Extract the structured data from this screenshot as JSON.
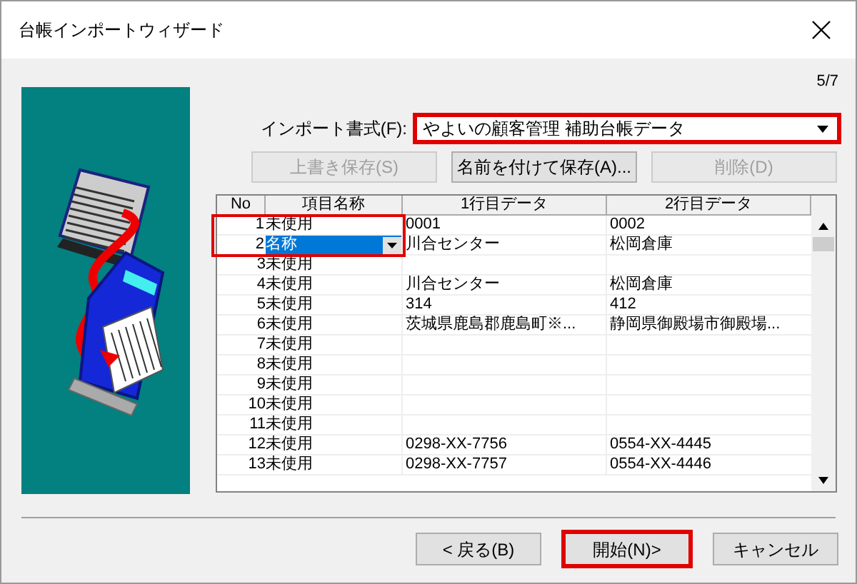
{
  "window": {
    "title": "台帳インポートウィザード",
    "step": "5/7"
  },
  "import_format": {
    "label": "インポート書式(F):",
    "value": "やよいの顧客管理 補助台帳データ",
    "annotated": true
  },
  "format_buttons": [
    {
      "label": "上書き保存(S)",
      "disabled": true
    },
    {
      "label": "名前を付けて保存(A)...",
      "disabled": false
    },
    {
      "label": "削除(D)",
      "disabled": true
    }
  ],
  "table": {
    "columns": [
      "No",
      "項目名称",
      "1行目データ",
      "2行目データ"
    ],
    "rows": [
      {
        "no": "1",
        "item": "未使用",
        "row1": "0001",
        "row2": "0002",
        "selected": false,
        "annotated": true
      },
      {
        "no": "2",
        "item": "名称",
        "row1": "川合センター",
        "row2": "松岡倉庫",
        "selected": true,
        "annotated": true
      },
      {
        "no": "3",
        "item": "未使用",
        "row1": "",
        "row2": "",
        "selected": false,
        "annotated": false
      },
      {
        "no": "4",
        "item": "未使用",
        "row1": "川合センター",
        "row2": "松岡倉庫",
        "selected": false,
        "annotated": false
      },
      {
        "no": "5",
        "item": "未使用",
        "row1": "314",
        "row2": "412",
        "selected": false,
        "annotated": false
      },
      {
        "no": "6",
        "item": "未使用",
        "row1": "茨城県鹿島郡鹿島町※...",
        "row2": "静岡県御殿場市御殿場...",
        "selected": false,
        "annotated": false
      },
      {
        "no": "7",
        "item": "未使用",
        "row1": "",
        "row2": "",
        "selected": false,
        "annotated": false
      },
      {
        "no": "8",
        "item": "未使用",
        "row1": "",
        "row2": "",
        "selected": false,
        "annotated": false
      },
      {
        "no": "9",
        "item": "未使用",
        "row1": "",
        "row2": "",
        "selected": false,
        "annotated": false
      },
      {
        "no": "10",
        "item": "未使用",
        "row1": "",
        "row2": "",
        "selected": false,
        "annotated": false
      },
      {
        "no": "11",
        "item": "未使用",
        "row1": "",
        "row2": "",
        "selected": false,
        "annotated": false
      },
      {
        "no": "12",
        "item": "未使用",
        "row1": "0298-XX-7756",
        "row2": "0554-XX-4445",
        "selected": false,
        "annotated": false
      },
      {
        "no": "13",
        "item": "未使用",
        "row1": "0298-XX-7757",
        "row2": "0554-XX-4446",
        "selected": false,
        "annotated": false
      }
    ]
  },
  "footer_buttons": [
    {
      "label": "< 戻る(B)",
      "annotated": false
    },
    {
      "label": "開始(N)>",
      "annotated": true
    },
    {
      "label": "キャンセル",
      "annotated": false
    }
  ]
}
